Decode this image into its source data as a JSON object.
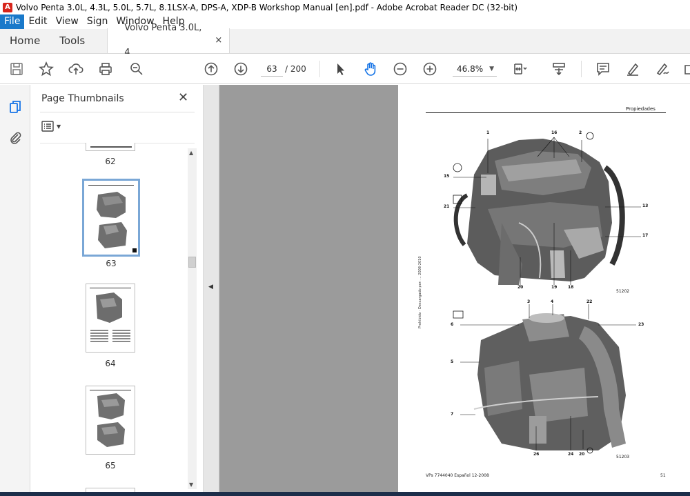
{
  "window": {
    "title": "Volvo Penta 3.0L, 4.3L, 5.0L, 5.7L, 8.1LSX-A, DPS-A, XDP-B Workshop Manual [en].pdf - Adobe Acrobat Reader DC (32-bit)"
  },
  "menu": {
    "items": [
      "File",
      "Edit",
      "View",
      "Sign",
      "Window",
      "Help"
    ]
  },
  "tabs": {
    "home": "Home",
    "tools": "Tools",
    "document": "Volvo Penta 3.0L, 4...",
    "close_glyph": "×"
  },
  "toolbar": {
    "current_page": "63",
    "total_pages": "/ 200",
    "zoom": "46.8%",
    "icons": [
      "save-icon",
      "star-icon",
      "upload-icon",
      "print-icon",
      "zoom-search-icon",
      "page-up-icon",
      "page-down-icon",
      "select-cursor-icon",
      "hand-icon",
      "zoom-out-icon",
      "zoom-in-icon",
      "fit-page-icon",
      "scroll-mode-icon",
      "comment-icon",
      "highlight-icon",
      "sign-icon"
    ]
  },
  "thumbnails_panel": {
    "title": "Page Thumbnails",
    "close_glyph": "✕",
    "pages": [
      {
        "label": "62"
      },
      {
        "label": "63",
        "selected": true
      },
      {
        "label": "64"
      },
      {
        "label": "65"
      }
    ]
  },
  "document_page": {
    "header": "Propiedades",
    "footer_left": "VPs 7744040 Español 12-2008",
    "footer_right": "51",
    "side_note": "Prohibido · Descargado por: ... 2008-2010",
    "callouts_top": [
      "1",
      "16",
      "2",
      "15",
      "21",
      "13",
      "17",
      "20",
      "19",
      "18",
      "51202"
    ],
    "callouts_bottom": [
      "3",
      "4",
      "22",
      "6",
      "23",
      "5",
      "7",
      "26",
      "24",
      "20",
      "51203"
    ]
  }
}
